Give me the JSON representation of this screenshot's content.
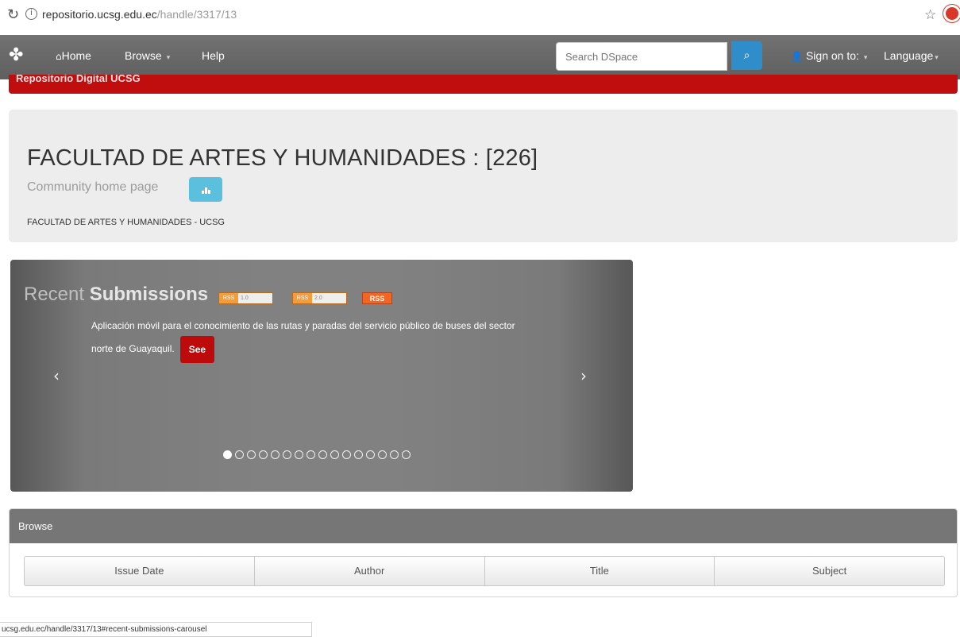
{
  "browser": {
    "url_domain": "repositorio.ucsg.edu.ec",
    "url_path": "/handle/3317/13",
    "status_url": "ucsg.edu.ec/handle/3317/13#recent-submissions-carousel"
  },
  "navbar": {
    "home": "Home",
    "browse": "Browse",
    "help": "Help",
    "search_placeholder": "Search DSpace",
    "sign_on": "Sign on to:",
    "language": "Language"
  },
  "header": {
    "repository_title": "Repositorio Digital UCSG"
  },
  "community": {
    "title": "FACULTAD DE ARTES Y HUMANIDADES : [226]",
    "subtitle": "Community home page",
    "description": "FACULTAD DE ARTES Y HUMANIDADES - UCSG"
  },
  "carousel": {
    "title_light": "Recent",
    "title_bold": "Submissions",
    "feeds": [
      {
        "left": "RSS",
        "right": "1.0"
      },
      {
        "left": "RSS",
        "right": "2.0"
      }
    ],
    "rss_label": "RSS",
    "item_text": "Aplicación móvil para el conocimiento de las rutas y paradas del servicio público de buses del sector norte de Guayaquil.",
    "see_label": "See",
    "indicator_count": 16,
    "active_index": 0
  },
  "browse": {
    "heading": "Browse",
    "buttons": [
      "Issue Date",
      "Author",
      "Title",
      "Subject"
    ]
  },
  "colors": {
    "navbar": "#666666",
    "brand_red": "#c00d0d",
    "search_button": "#2f8ec9",
    "stats_button": "#5bc0de"
  }
}
